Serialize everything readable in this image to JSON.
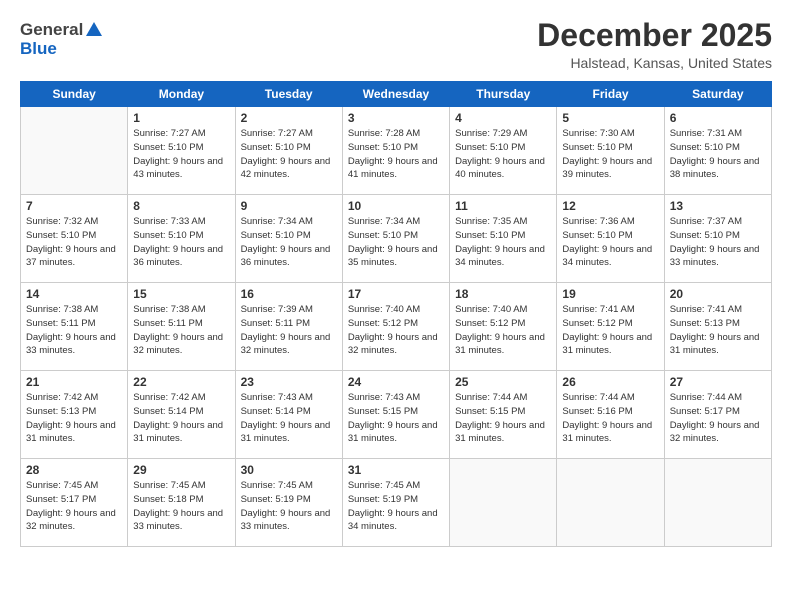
{
  "logo": {
    "line1": "General",
    "line2": "Blue"
  },
  "title": "December 2025",
  "subtitle": "Halstead, Kansas, United States",
  "days_of_week": [
    "Sunday",
    "Monday",
    "Tuesday",
    "Wednesday",
    "Thursday",
    "Friday",
    "Saturday"
  ],
  "weeks": [
    [
      {
        "day": "",
        "sunrise": "",
        "sunset": "",
        "daylight": ""
      },
      {
        "day": "1",
        "sunrise": "Sunrise: 7:27 AM",
        "sunset": "Sunset: 5:10 PM",
        "daylight": "Daylight: 9 hours and 43 minutes."
      },
      {
        "day": "2",
        "sunrise": "Sunrise: 7:27 AM",
        "sunset": "Sunset: 5:10 PM",
        "daylight": "Daylight: 9 hours and 42 minutes."
      },
      {
        "day": "3",
        "sunrise": "Sunrise: 7:28 AM",
        "sunset": "Sunset: 5:10 PM",
        "daylight": "Daylight: 9 hours and 41 minutes."
      },
      {
        "day": "4",
        "sunrise": "Sunrise: 7:29 AM",
        "sunset": "Sunset: 5:10 PM",
        "daylight": "Daylight: 9 hours and 40 minutes."
      },
      {
        "day": "5",
        "sunrise": "Sunrise: 7:30 AM",
        "sunset": "Sunset: 5:10 PM",
        "daylight": "Daylight: 9 hours and 39 minutes."
      },
      {
        "day": "6",
        "sunrise": "Sunrise: 7:31 AM",
        "sunset": "Sunset: 5:10 PM",
        "daylight": "Daylight: 9 hours and 38 minutes."
      }
    ],
    [
      {
        "day": "7",
        "sunrise": "Sunrise: 7:32 AM",
        "sunset": "Sunset: 5:10 PM",
        "daylight": "Daylight: 9 hours and 37 minutes."
      },
      {
        "day": "8",
        "sunrise": "Sunrise: 7:33 AM",
        "sunset": "Sunset: 5:10 PM",
        "daylight": "Daylight: 9 hours and 36 minutes."
      },
      {
        "day": "9",
        "sunrise": "Sunrise: 7:34 AM",
        "sunset": "Sunset: 5:10 PM",
        "daylight": "Daylight: 9 hours and 36 minutes."
      },
      {
        "day": "10",
        "sunrise": "Sunrise: 7:34 AM",
        "sunset": "Sunset: 5:10 PM",
        "daylight": "Daylight: 9 hours and 35 minutes."
      },
      {
        "day": "11",
        "sunrise": "Sunrise: 7:35 AM",
        "sunset": "Sunset: 5:10 PM",
        "daylight": "Daylight: 9 hours and 34 minutes."
      },
      {
        "day": "12",
        "sunrise": "Sunrise: 7:36 AM",
        "sunset": "Sunset: 5:10 PM",
        "daylight": "Daylight: 9 hours and 34 minutes."
      },
      {
        "day": "13",
        "sunrise": "Sunrise: 7:37 AM",
        "sunset": "Sunset: 5:10 PM",
        "daylight": "Daylight: 9 hours and 33 minutes."
      }
    ],
    [
      {
        "day": "14",
        "sunrise": "Sunrise: 7:38 AM",
        "sunset": "Sunset: 5:11 PM",
        "daylight": "Daylight: 9 hours and 33 minutes."
      },
      {
        "day": "15",
        "sunrise": "Sunrise: 7:38 AM",
        "sunset": "Sunset: 5:11 PM",
        "daylight": "Daylight: 9 hours and 32 minutes."
      },
      {
        "day": "16",
        "sunrise": "Sunrise: 7:39 AM",
        "sunset": "Sunset: 5:11 PM",
        "daylight": "Daylight: 9 hours and 32 minutes."
      },
      {
        "day": "17",
        "sunrise": "Sunrise: 7:40 AM",
        "sunset": "Sunset: 5:12 PM",
        "daylight": "Daylight: 9 hours and 32 minutes."
      },
      {
        "day": "18",
        "sunrise": "Sunrise: 7:40 AM",
        "sunset": "Sunset: 5:12 PM",
        "daylight": "Daylight: 9 hours and 31 minutes."
      },
      {
        "day": "19",
        "sunrise": "Sunrise: 7:41 AM",
        "sunset": "Sunset: 5:12 PM",
        "daylight": "Daylight: 9 hours and 31 minutes."
      },
      {
        "day": "20",
        "sunrise": "Sunrise: 7:41 AM",
        "sunset": "Sunset: 5:13 PM",
        "daylight": "Daylight: 9 hours and 31 minutes."
      }
    ],
    [
      {
        "day": "21",
        "sunrise": "Sunrise: 7:42 AM",
        "sunset": "Sunset: 5:13 PM",
        "daylight": "Daylight: 9 hours and 31 minutes."
      },
      {
        "day": "22",
        "sunrise": "Sunrise: 7:42 AM",
        "sunset": "Sunset: 5:14 PM",
        "daylight": "Daylight: 9 hours and 31 minutes."
      },
      {
        "day": "23",
        "sunrise": "Sunrise: 7:43 AM",
        "sunset": "Sunset: 5:14 PM",
        "daylight": "Daylight: 9 hours and 31 minutes."
      },
      {
        "day": "24",
        "sunrise": "Sunrise: 7:43 AM",
        "sunset": "Sunset: 5:15 PM",
        "daylight": "Daylight: 9 hours and 31 minutes."
      },
      {
        "day": "25",
        "sunrise": "Sunrise: 7:44 AM",
        "sunset": "Sunset: 5:15 PM",
        "daylight": "Daylight: 9 hours and 31 minutes."
      },
      {
        "day": "26",
        "sunrise": "Sunrise: 7:44 AM",
        "sunset": "Sunset: 5:16 PM",
        "daylight": "Daylight: 9 hours and 31 minutes."
      },
      {
        "day": "27",
        "sunrise": "Sunrise: 7:44 AM",
        "sunset": "Sunset: 5:17 PM",
        "daylight": "Daylight: 9 hours and 32 minutes."
      }
    ],
    [
      {
        "day": "28",
        "sunrise": "Sunrise: 7:45 AM",
        "sunset": "Sunset: 5:17 PM",
        "daylight": "Daylight: 9 hours and 32 minutes."
      },
      {
        "day": "29",
        "sunrise": "Sunrise: 7:45 AM",
        "sunset": "Sunset: 5:18 PM",
        "daylight": "Daylight: 9 hours and 33 minutes."
      },
      {
        "day": "30",
        "sunrise": "Sunrise: 7:45 AM",
        "sunset": "Sunset: 5:19 PM",
        "daylight": "Daylight: 9 hours and 33 minutes."
      },
      {
        "day": "31",
        "sunrise": "Sunrise: 7:45 AM",
        "sunset": "Sunset: 5:19 PM",
        "daylight": "Daylight: 9 hours and 34 minutes."
      },
      {
        "day": "",
        "sunrise": "",
        "sunset": "",
        "daylight": ""
      },
      {
        "day": "",
        "sunrise": "",
        "sunset": "",
        "daylight": ""
      },
      {
        "day": "",
        "sunrise": "",
        "sunset": "",
        "daylight": ""
      }
    ]
  ]
}
